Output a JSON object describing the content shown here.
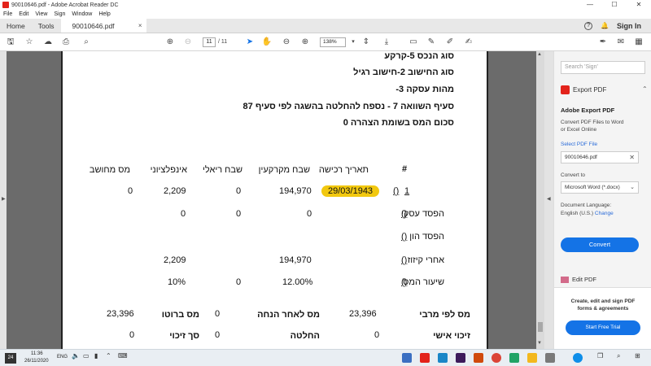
{
  "window": {
    "title": "90010646.pdf - Adobe Acrobat Reader DC",
    "minimize": "—",
    "maximize": "☐",
    "close": "✕"
  },
  "menu": [
    "File",
    "Edit",
    "View",
    "Sign",
    "Window",
    "Help"
  ],
  "tabs": {
    "home": "Home",
    "tools": "Tools",
    "doc": "90010646.pdf",
    "doc_close": "×"
  },
  "header": {
    "help_icon": "?",
    "bell_icon": "🔔",
    "signin": "Sign In"
  },
  "toolbar": {
    "page_current": "11",
    "page_total": "/ 11",
    "zoom": "138%"
  },
  "document": {
    "lines": [
      "סוג הנכס 5-קרקע",
      "סוג החישוב 2-חישוב רגיל",
      "מהות עסקה 3-",
      "סעיף השוואה 7 - נספח להחלטה בהשגה לפי סעיף 87",
      "סכום המס בשומת הצהרה 0"
    ],
    "headers": {
      "hash": "#",
      "purchase_date": "תאריך רכישה",
      "land_appreciation": "שבח מקרקעין",
      "real_appreciation": "שבח ריאלי",
      "inflationary": "אינפלציוני",
      "computed_tax": "מס מחושב"
    },
    "row1": {
      "num": "1",
      "paren": "()",
      "purchase_date": "29/03/1943",
      "land_appreciation": "194,970",
      "real_appreciation": "0",
      "inflationary": "2,209",
      "computed_tax": "0"
    },
    "business_loss": {
      "label": "הפסד עסקי",
      "paren": "()",
      "land_appreciation": "0",
      "real_appreciation": "0",
      "inflationary": "0"
    },
    "capital_loss": {
      "label": "הפסד הון",
      "paren": "()"
    },
    "after_offset": {
      "label": "אחרי קיזוז",
      "paren": "()",
      "land_appreciation": "194,970",
      "inflationary": "2,209"
    },
    "tax_rate": {
      "label": "שיעור המס",
      "paren": "()",
      "land_appreciation": "12.00%",
      "real_appreciation": "0",
      "inflationary": "10%"
    },
    "summary1": {
      "max_tax_label": "מס לפי מרבי",
      "max_tax_value": "23,396",
      "after_discount_label": "מס לאחר הנחה",
      "gross_value": "0",
      "gross_label": "מס ברוטו",
      "gross_total": "23,396"
    },
    "summary2": {
      "personal_credit_label": "זיכוי אישי",
      "personal_credit_value": "0",
      "decision_label": "החלטה",
      "credit_total_value": "0",
      "credit_total_label": "סך זיכוי",
      "last_value": "0"
    }
  },
  "pane": {
    "search_placeholder": "Search 'Sign'",
    "export_header": "Export PDF",
    "export_title": "Adobe Export PDF",
    "export_desc_1": "Convert PDF Files to Word",
    "export_desc_2": "or Excel Online",
    "select_file": "Select PDF File",
    "file_name": "90010646.pdf",
    "file_remove": "✕",
    "convert_to_label": "Convert to",
    "convert_to_value": "Microsoft Word (*.docx)",
    "doc_lang_label": "Document Language:",
    "doc_lang_value": "English (U.S.)",
    "doc_lang_change": "Change",
    "convert_button": "Convert",
    "edit_pdf": "Edit PDF",
    "promo_1": "Create, edit and sign PDF",
    "promo_2": "forms & agreements",
    "trial_button": "Start Free Trial"
  },
  "taskbar": {
    "badge": "24",
    "time": "11:36",
    "date": "26/11/2020",
    "lang": "ENG"
  }
}
